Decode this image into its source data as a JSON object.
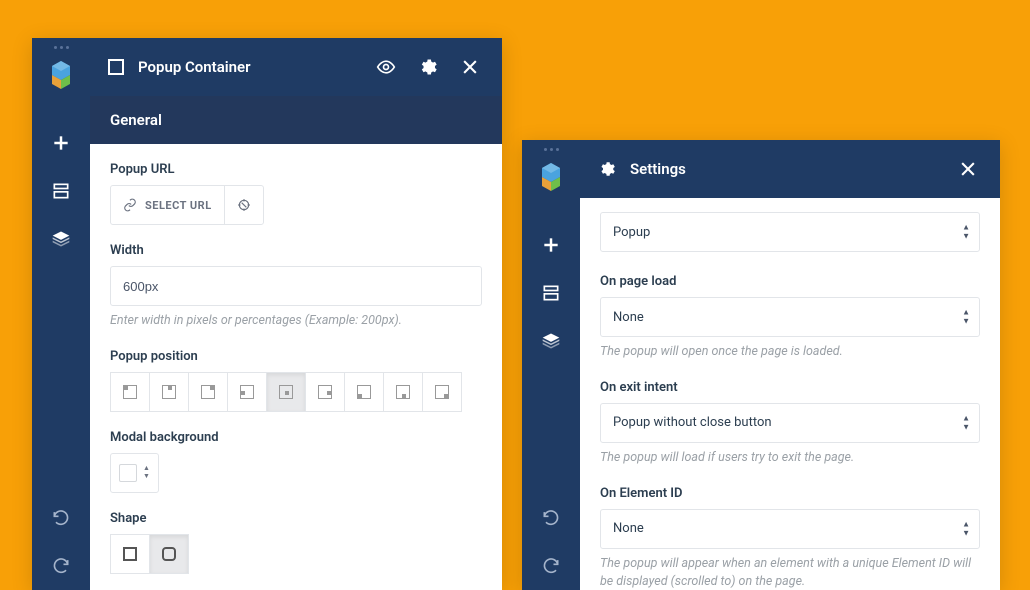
{
  "left": {
    "header": {
      "title": "Popup Container"
    },
    "section": "General",
    "popup_url": {
      "label": "Popup URL",
      "button": "SELECT URL"
    },
    "width": {
      "label": "Width",
      "value": "600px",
      "help": "Enter width in pixels or percentages (Example: 200px)."
    },
    "position": {
      "label": "Popup position",
      "selected": 4
    },
    "modal_bg": {
      "label": "Modal background"
    },
    "shape": {
      "label": "Shape",
      "selected": 1
    }
  },
  "right": {
    "header": {
      "title": "Settings"
    },
    "type_select": "Popup",
    "on_page_load": {
      "label": "On page load",
      "value": "None",
      "help": "The popup will open once the page is loaded."
    },
    "on_exit_intent": {
      "label": "On exit intent",
      "value": "Popup without close button",
      "help": "The popup will load if users try to exit the page."
    },
    "on_element_id": {
      "label": "On Element ID",
      "value": "None",
      "help": "The popup will appear when an element with a unique Element ID will be displayed (scrolled to) on the page."
    }
  }
}
